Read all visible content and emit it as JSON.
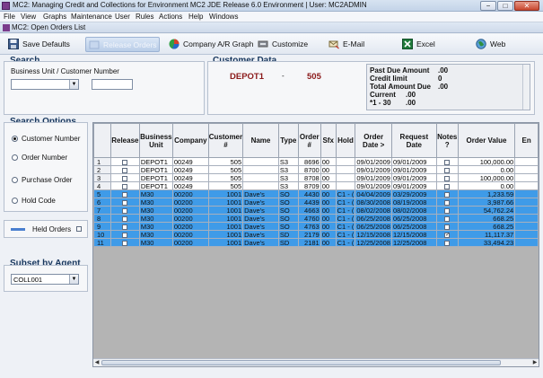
{
  "window": {
    "title": "MC2: Managing Credit and Collections for Environment MC2 JDE Release 6.0 Environment  |  User: MC2ADMIN",
    "minimize": "−",
    "maximize": "□",
    "close": "✕"
  },
  "menu": [
    "File",
    "View",
    "Graphs",
    "Maintenance",
    "User",
    "Rules",
    "Actions",
    "Help",
    "Windows"
  ],
  "child_window": {
    "title": "MC2: Open Orders List"
  },
  "toolbar": {
    "save_defaults": "Save Defaults",
    "release_orders": "Release Orders",
    "company_ar_graph": "Company A/R Graph",
    "customize": "Customize",
    "email": "E-Mail",
    "excel": "Excel",
    "web": "Web"
  },
  "search": {
    "title": "Search",
    "label": "Business Unit / Customer Number",
    "business_unit_value": "",
    "customer_number_value": ""
  },
  "search_options": {
    "title": "Search Options",
    "options": [
      "Customer Number",
      "Order Number",
      "Purchase Order",
      "Hold Code"
    ],
    "selected": "Customer Number"
  },
  "held_orders": {
    "label": "Held Orders"
  },
  "subset_by_agent": {
    "title": "Subset by Agent",
    "value": "COLL001"
  },
  "customer_data": {
    "title": "Customer Data",
    "business_unit": "DEPOT1",
    "separator": "-",
    "customer_number": "505",
    "summary": [
      {
        "label": "Past Due Amount",
        "value": ".00"
      },
      {
        "label": "Credit limit",
        "value": "0"
      },
      {
        "label": "Total Amount Due",
        "value": ".00"
      },
      {
        "label": "Current",
        "value": ".00"
      },
      {
        "label": "*1 - 30",
        "value": ".00"
      }
    ]
  },
  "grid": {
    "columns": [
      "Release",
      "Business Unit",
      "Company",
      "Customer #",
      "Name",
      "Type",
      "Order #",
      "Sfx",
      "Hold",
      "Order Date >",
      "Request Date",
      "Notes ?",
      "Order Value",
      "En"
    ],
    "rows": [
      {
        "n": "1",
        "release": false,
        "bu": "DEPOT1",
        "company": "00249",
        "cust": "505",
        "name": "",
        "type": "S3",
        "order": "8696",
        "sfx": "00",
        "hold": "",
        "order_date": "09/01/2009",
        "request_date": "09/01/2009",
        "notes": false,
        "value": "100,000.00",
        "selected": false
      },
      {
        "n": "2",
        "release": false,
        "bu": "DEPOT1",
        "company": "00249",
        "cust": "505",
        "name": "",
        "type": "S3",
        "order": "8700",
        "sfx": "00",
        "hold": "",
        "order_date": "09/01/2009",
        "request_date": "09/01/2009",
        "notes": false,
        "value": "0.00",
        "selected": false
      },
      {
        "n": "3",
        "release": false,
        "bu": "DEPOT1",
        "company": "00249",
        "cust": "505",
        "name": "",
        "type": "S3",
        "order": "8708",
        "sfx": "00",
        "hold": "",
        "order_date": "09/01/2009",
        "request_date": "09/01/2009",
        "notes": false,
        "value": "100,000.00",
        "selected": false
      },
      {
        "n": "4",
        "release": false,
        "bu": "DEPOT1",
        "company": "00249",
        "cust": "505",
        "name": "",
        "type": "S3",
        "order": "8709",
        "sfx": "00",
        "hold": "",
        "order_date": "09/01/2009",
        "request_date": "09/01/2009",
        "notes": false,
        "value": "0.00",
        "selected": false
      },
      {
        "n": "5",
        "release": false,
        "bu": "M30",
        "company": "00200",
        "cust": "1001",
        "name": "Dave's",
        "type": "SO",
        "order": "4430",
        "sfx": "00",
        "hold": "C1 - (",
        "order_date": "04/04/2009",
        "request_date": "03/29/2009",
        "notes": false,
        "value": "1,233.59",
        "selected": true
      },
      {
        "n": "6",
        "release": false,
        "bu": "M30",
        "company": "00200",
        "cust": "1001",
        "name": "Dave's",
        "type": "SO",
        "order": "4439",
        "sfx": "00",
        "hold": "C1 - (",
        "order_date": "08/30/2008",
        "request_date": "08/19/2008",
        "notes": false,
        "value": "3,987.66",
        "selected": true
      },
      {
        "n": "7",
        "release": false,
        "bu": "M30",
        "company": "00200",
        "cust": "1001",
        "name": "Dave's",
        "type": "SO",
        "order": "4663",
        "sfx": "00",
        "hold": "C1 - (",
        "order_date": "08/02/2008",
        "request_date": "08/02/2008",
        "notes": false,
        "value": "54,762.24",
        "selected": true
      },
      {
        "n": "8",
        "release": false,
        "bu": "M30",
        "company": "00200",
        "cust": "1001",
        "name": "Dave's",
        "type": "SO",
        "order": "4760",
        "sfx": "00",
        "hold": "C1 - (",
        "order_date": "06/25/2008",
        "request_date": "06/25/2008",
        "notes": false,
        "value": "668.25",
        "selected": true
      },
      {
        "n": "9",
        "release": false,
        "bu": "M30",
        "company": "00200",
        "cust": "1001",
        "name": "Dave's",
        "type": "SO",
        "order": "4763",
        "sfx": "00",
        "hold": "C1 - (",
        "order_date": "06/25/2008",
        "request_date": "06/25/2008",
        "notes": false,
        "value": "668.25",
        "selected": true
      },
      {
        "n": "10",
        "release": false,
        "bu": "M30",
        "company": "00200",
        "cust": "1001",
        "name": "Dave's",
        "type": "SD",
        "order": "2179",
        "sfx": "00",
        "hold": "C1 - (",
        "order_date": "12/15/2008",
        "request_date": "12/15/2008",
        "notes": true,
        "value": "11,117.37",
        "selected": true
      },
      {
        "n": "11",
        "release": false,
        "bu": "M30",
        "company": "00200",
        "cust": "1001",
        "name": "Dave's",
        "type": "SD",
        "order": "2181",
        "sfx": "00",
        "hold": "C1 - (",
        "order_date": "12/25/2008",
        "request_date": "12/25/2008",
        "notes": false,
        "value": "33,494.23",
        "selected": true
      }
    ]
  }
}
